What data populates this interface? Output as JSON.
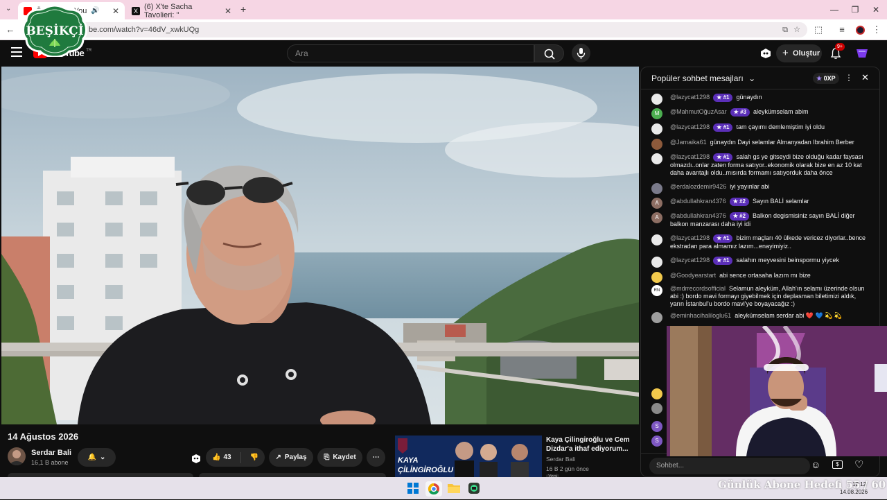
{
  "browser": {
    "tabs": [
      {
        "label": "Ö... 2026 - You",
        "icon": "youtube-icon",
        "active": true
      },
      {
        "label": "(6) X'te Sacha Tavolieri: \"",
        "icon": "x-icon",
        "active": false
      }
    ],
    "url": "be.com/watch?v=46dV_xwkUQg",
    "new_tab": "+"
  },
  "logo": {
    "text": "BEŞİKÇİ",
    "brand_color": "#1f7a3e"
  },
  "youtube": {
    "search_placeholder": "Ara",
    "create_label": "Oluştur",
    "notif_badge": "9+",
    "logo_text": "YouTube",
    "logo_region": "TR"
  },
  "video": {
    "title": "14 Ağustos 2026",
    "channel": "Serdar Bali",
    "subs": "16,1 B abone",
    "likes": "43",
    "share_label": "Paylaş",
    "save_label": "Kaydet"
  },
  "recommended": {
    "thumb_text_1": "KAYA",
    "thumb_text_2": "ÇİLİNGİROĞLU",
    "title": "Kaya Çilingiroğlu ve Cem Dizdar'a ithaf ediyorum...",
    "channel": "Serdar Bali",
    "meta": "16 B  2 gün önce",
    "tag": "Yeni"
  },
  "chat": {
    "header": "Popüler sohbet mesajları",
    "xp": "0XP",
    "input_placeholder": "Sohbet...",
    "messages": [
      {
        "user": "@lazycat1298",
        "badge": "#1",
        "text": "günaydın",
        "avatar_color": "#e9e9e9",
        "avatar_letter": ""
      },
      {
        "user": "@MahmutOğuzAsar",
        "badge": "#3",
        "text": "aleykümselam abim",
        "avatar_color": "#4caf50",
        "avatar_letter": "M"
      },
      {
        "user": "@lazycat1298",
        "badge": "#1",
        "text": "tam çayımı demlemiştim iyi oldu",
        "avatar_color": "#e9e9e9",
        "avatar_letter": ""
      },
      {
        "user": "@Jamaika61",
        "badge": "",
        "text": "günaydın Dayi selamlar Almanyadan Ibrahim Berber",
        "avatar_color": "#8d5a3b",
        "avatar_letter": ""
      },
      {
        "user": "@lazycat1298",
        "badge": "#1",
        "text": "salah gs ye gitseydi bize olduğu kadar faysası olmazdı..onlar zaten forma satıyor..ekonomik olarak bize en az 10 kat daha avantajlı oldu..mısırda formamı satıyorduk daha önce",
        "avatar_color": "#e9e9e9",
        "avatar_letter": ""
      },
      {
        "user": "@erdalozdemir9426",
        "badge": "",
        "text": "iyi yayınlar abi",
        "avatar_color": "#7a7a8a",
        "avatar_letter": ""
      },
      {
        "user": "@abdullahkran4376",
        "badge": "#2",
        "text": "Sayın BALİ selamlar",
        "avatar_color": "#8d6e63",
        "avatar_letter": "A"
      },
      {
        "user": "@abdullahkran4376",
        "badge": "#2",
        "text": "Balkon degismisiniz sayın BALİ diğer balkon manzarası daha iyi idi",
        "avatar_color": "#8d6e63",
        "avatar_letter": "A"
      },
      {
        "user": "@lazycat1298",
        "badge": "#1",
        "text": "bizim maçları 40 ülkede vericez diyorlar..bence ekstradan para almamız lazım...enayimiyiz..",
        "avatar_color": "#e9e9e9",
        "avatar_letter": ""
      },
      {
        "user": "@lazycat1298",
        "badge": "#1",
        "text": "salahın meyvesini beinspormu yiycek",
        "avatar_color": "#e9e9e9",
        "avatar_letter": ""
      },
      {
        "user": "@Goodyearstart",
        "badge": "",
        "text": "abi sence ortasaha lazım mı bize",
        "avatar_color": "#f2c94c",
        "avatar_letter": ""
      },
      {
        "user": "@mdrrecordsofficial",
        "badge": "",
        "text": "Selamun aleyküm, Allah'ın selamı üzerinde olsun abi :) bordo mavi formayı giyebilmek için deplasman biletimizi aldık, yarın İstanbul'u bordo mavi'ye boyayacağız :)",
        "avatar_color": "#ffffff",
        "avatar_letter": "RN"
      },
      {
        "user": "@eminhacihaliloglu61",
        "badge": "",
        "text": "aleykümselam serdar abi ❤️ 💙 💫 💫",
        "avatar_color": "#9e9e9e",
        "avatar_letter": ""
      }
    ]
  },
  "taskbar": {
    "ticker": "Günlük Abone Hedefi 55 / 60",
    "time": "12:12",
    "date": "14.08.2026"
  }
}
